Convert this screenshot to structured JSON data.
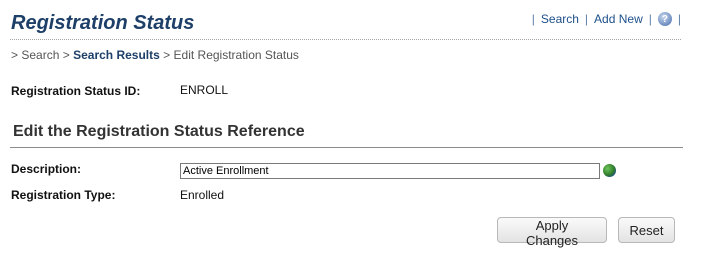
{
  "header": {
    "title": "Registration Status",
    "links": {
      "separator": "|",
      "search": "Search",
      "add_new": "Add New",
      "help_glyph": "?"
    }
  },
  "breadcrumb": {
    "prefix": ">",
    "items": [
      "Search",
      "Search Results",
      "Edit Registration Status"
    ],
    "separator": ">"
  },
  "details": {
    "status_id_label": "Registration Status ID:",
    "status_id_value": "ENROLL"
  },
  "section": {
    "title": "Edit the Registration Status Reference"
  },
  "form": {
    "description_label": "Description:",
    "description_value": "Active Enrollment",
    "registration_type_label": "Registration Type:",
    "registration_type_value": "Enrolled"
  },
  "buttons": {
    "apply": "Apply Changes",
    "reset": "Reset"
  },
  "icons": {
    "help": "help-icon",
    "translate": "globe-icon"
  },
  "colors": {
    "title": "#1d3f68",
    "link": "#1d4f8a"
  }
}
